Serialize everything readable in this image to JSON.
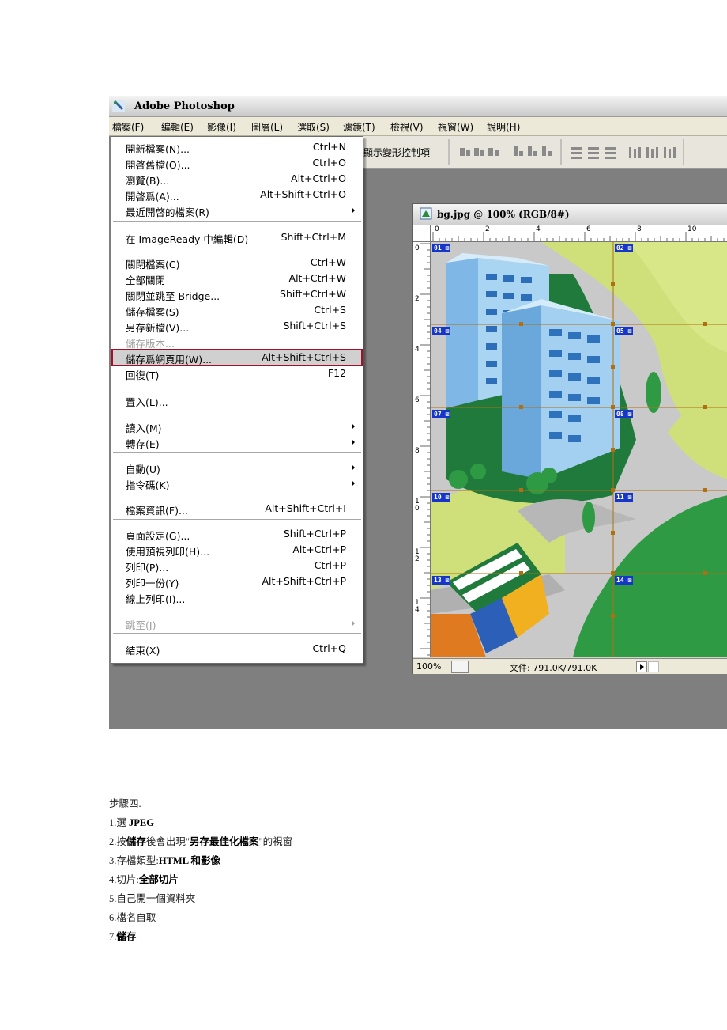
{
  "app": {
    "title": "Adobe Photoshop"
  },
  "menubar": [
    "檔案(F)",
    "編輯(E)",
    "影像(I)",
    "圖層(L)",
    "選取(S)",
    "濾鏡(T)",
    "檢視(V)",
    "視窗(W)",
    "說明(H)"
  ],
  "options_bar": {
    "label": "顯示變形控制項"
  },
  "file_menu": [
    {
      "label": "開新檔案(N)...",
      "shortcut": "Ctrl+N"
    },
    {
      "label": "開啓舊檔(O)...",
      "shortcut": "Ctrl+O"
    },
    {
      "label": "瀏覽(B)...",
      "shortcut": "Alt+Ctrl+O"
    },
    {
      "label": "開啓爲(A)...",
      "shortcut": "Alt+Shift+Ctrl+O"
    },
    {
      "label": "最近開啓的檔案(R)",
      "shortcut": "",
      "submenu": true
    },
    {
      "label": "在 ImageReady 中編輯(D)",
      "shortcut": "Shift+Ctrl+M"
    },
    {
      "label": "關閉檔案(C)",
      "shortcut": "Ctrl+W"
    },
    {
      "label": "全部關閉",
      "shortcut": "Alt+Ctrl+W"
    },
    {
      "label": "關閉並跳至 Bridge...",
      "shortcut": "Shift+Ctrl+W"
    },
    {
      "label": "儲存檔案(S)",
      "shortcut": "Ctrl+S"
    },
    {
      "label": "另存新檔(V)...",
      "shortcut": "Shift+Ctrl+S"
    },
    {
      "label": "儲存版本...",
      "shortcut": "",
      "disabled": true
    },
    {
      "label": "儲存爲網頁用(W)...",
      "shortcut": "Alt+Shift+Ctrl+S",
      "highlighted": true
    },
    {
      "label": "回復(T)",
      "shortcut": "F12"
    },
    {
      "label": "置入(L)...",
      "shortcut": ""
    },
    {
      "label": "讀入(M)",
      "shortcut": "",
      "submenu": true
    },
    {
      "label": "轉存(E)",
      "shortcut": "",
      "submenu": true
    },
    {
      "label": "自動(U)",
      "shortcut": "",
      "submenu": true
    },
    {
      "label": "指令碼(K)",
      "shortcut": "",
      "submenu": true
    },
    {
      "label": "檔案資訊(F)...",
      "shortcut": "Alt+Shift+Ctrl+I"
    },
    {
      "label": "頁面設定(G)...",
      "shortcut": "Shift+Ctrl+P"
    },
    {
      "label": "使用預視列印(H)...",
      "shortcut": "Alt+Ctrl+P"
    },
    {
      "label": "列印(P)...",
      "shortcut": "Ctrl+P"
    },
    {
      "label": "列印一份(Y)",
      "shortcut": "Alt+Shift+Ctrl+P"
    },
    {
      "label": "線上列印(I)...",
      "shortcut": ""
    },
    {
      "label": "跳至(J)",
      "shortcut": "",
      "submenu": true,
      "disabled": true
    },
    {
      "label": "結束(X)",
      "shortcut": "Ctrl+Q"
    }
  ],
  "document": {
    "title": "bg.jpg @ 100% (RGB/8#)",
    "zoom": "100%",
    "file_info": "文件: 791.0K/791.0K",
    "ruler_top": [
      "0",
      "2",
      "4",
      "6",
      "8",
      "10"
    ],
    "ruler_left": [
      "0",
      "2",
      "4",
      "6",
      "8",
      "1\n0",
      "1\n2",
      "1\n4"
    ],
    "slices": [
      "01",
      "02",
      "04",
      "05",
      "07",
      "08",
      "10",
      "11",
      "13",
      "14"
    ]
  },
  "steps": {
    "heading": "步驟四.",
    "items": [
      [
        {
          "t": "1.選 "
        },
        {
          "t": "JPEG",
          "b": true
        }
      ],
      [
        {
          "t": "2.按"
        },
        {
          "t": "儲存",
          "b": true
        },
        {
          "t": "後會出現\""
        },
        {
          "t": "另存最佳化檔案",
          "b": true
        },
        {
          "t": "\"的視窗"
        }
      ],
      [
        {
          "t": "3.存檔類型:"
        },
        {
          "t": "HTML 和影像",
          "b": true
        }
      ],
      [
        {
          "t": "4.切片:"
        },
        {
          "t": "全部切片",
          "b": true
        }
      ],
      [
        {
          "t": "5.自己開一個資料夾"
        }
      ],
      [
        {
          "t": "6.檔名自取"
        }
      ],
      [
        {
          "t": "7."
        },
        {
          "t": "儲存",
          "b": true
        }
      ]
    ]
  },
  "colors": {
    "highlight_border": "#a01028",
    "slice_badge": "#1536c8",
    "slice_line": "#b07010"
  }
}
